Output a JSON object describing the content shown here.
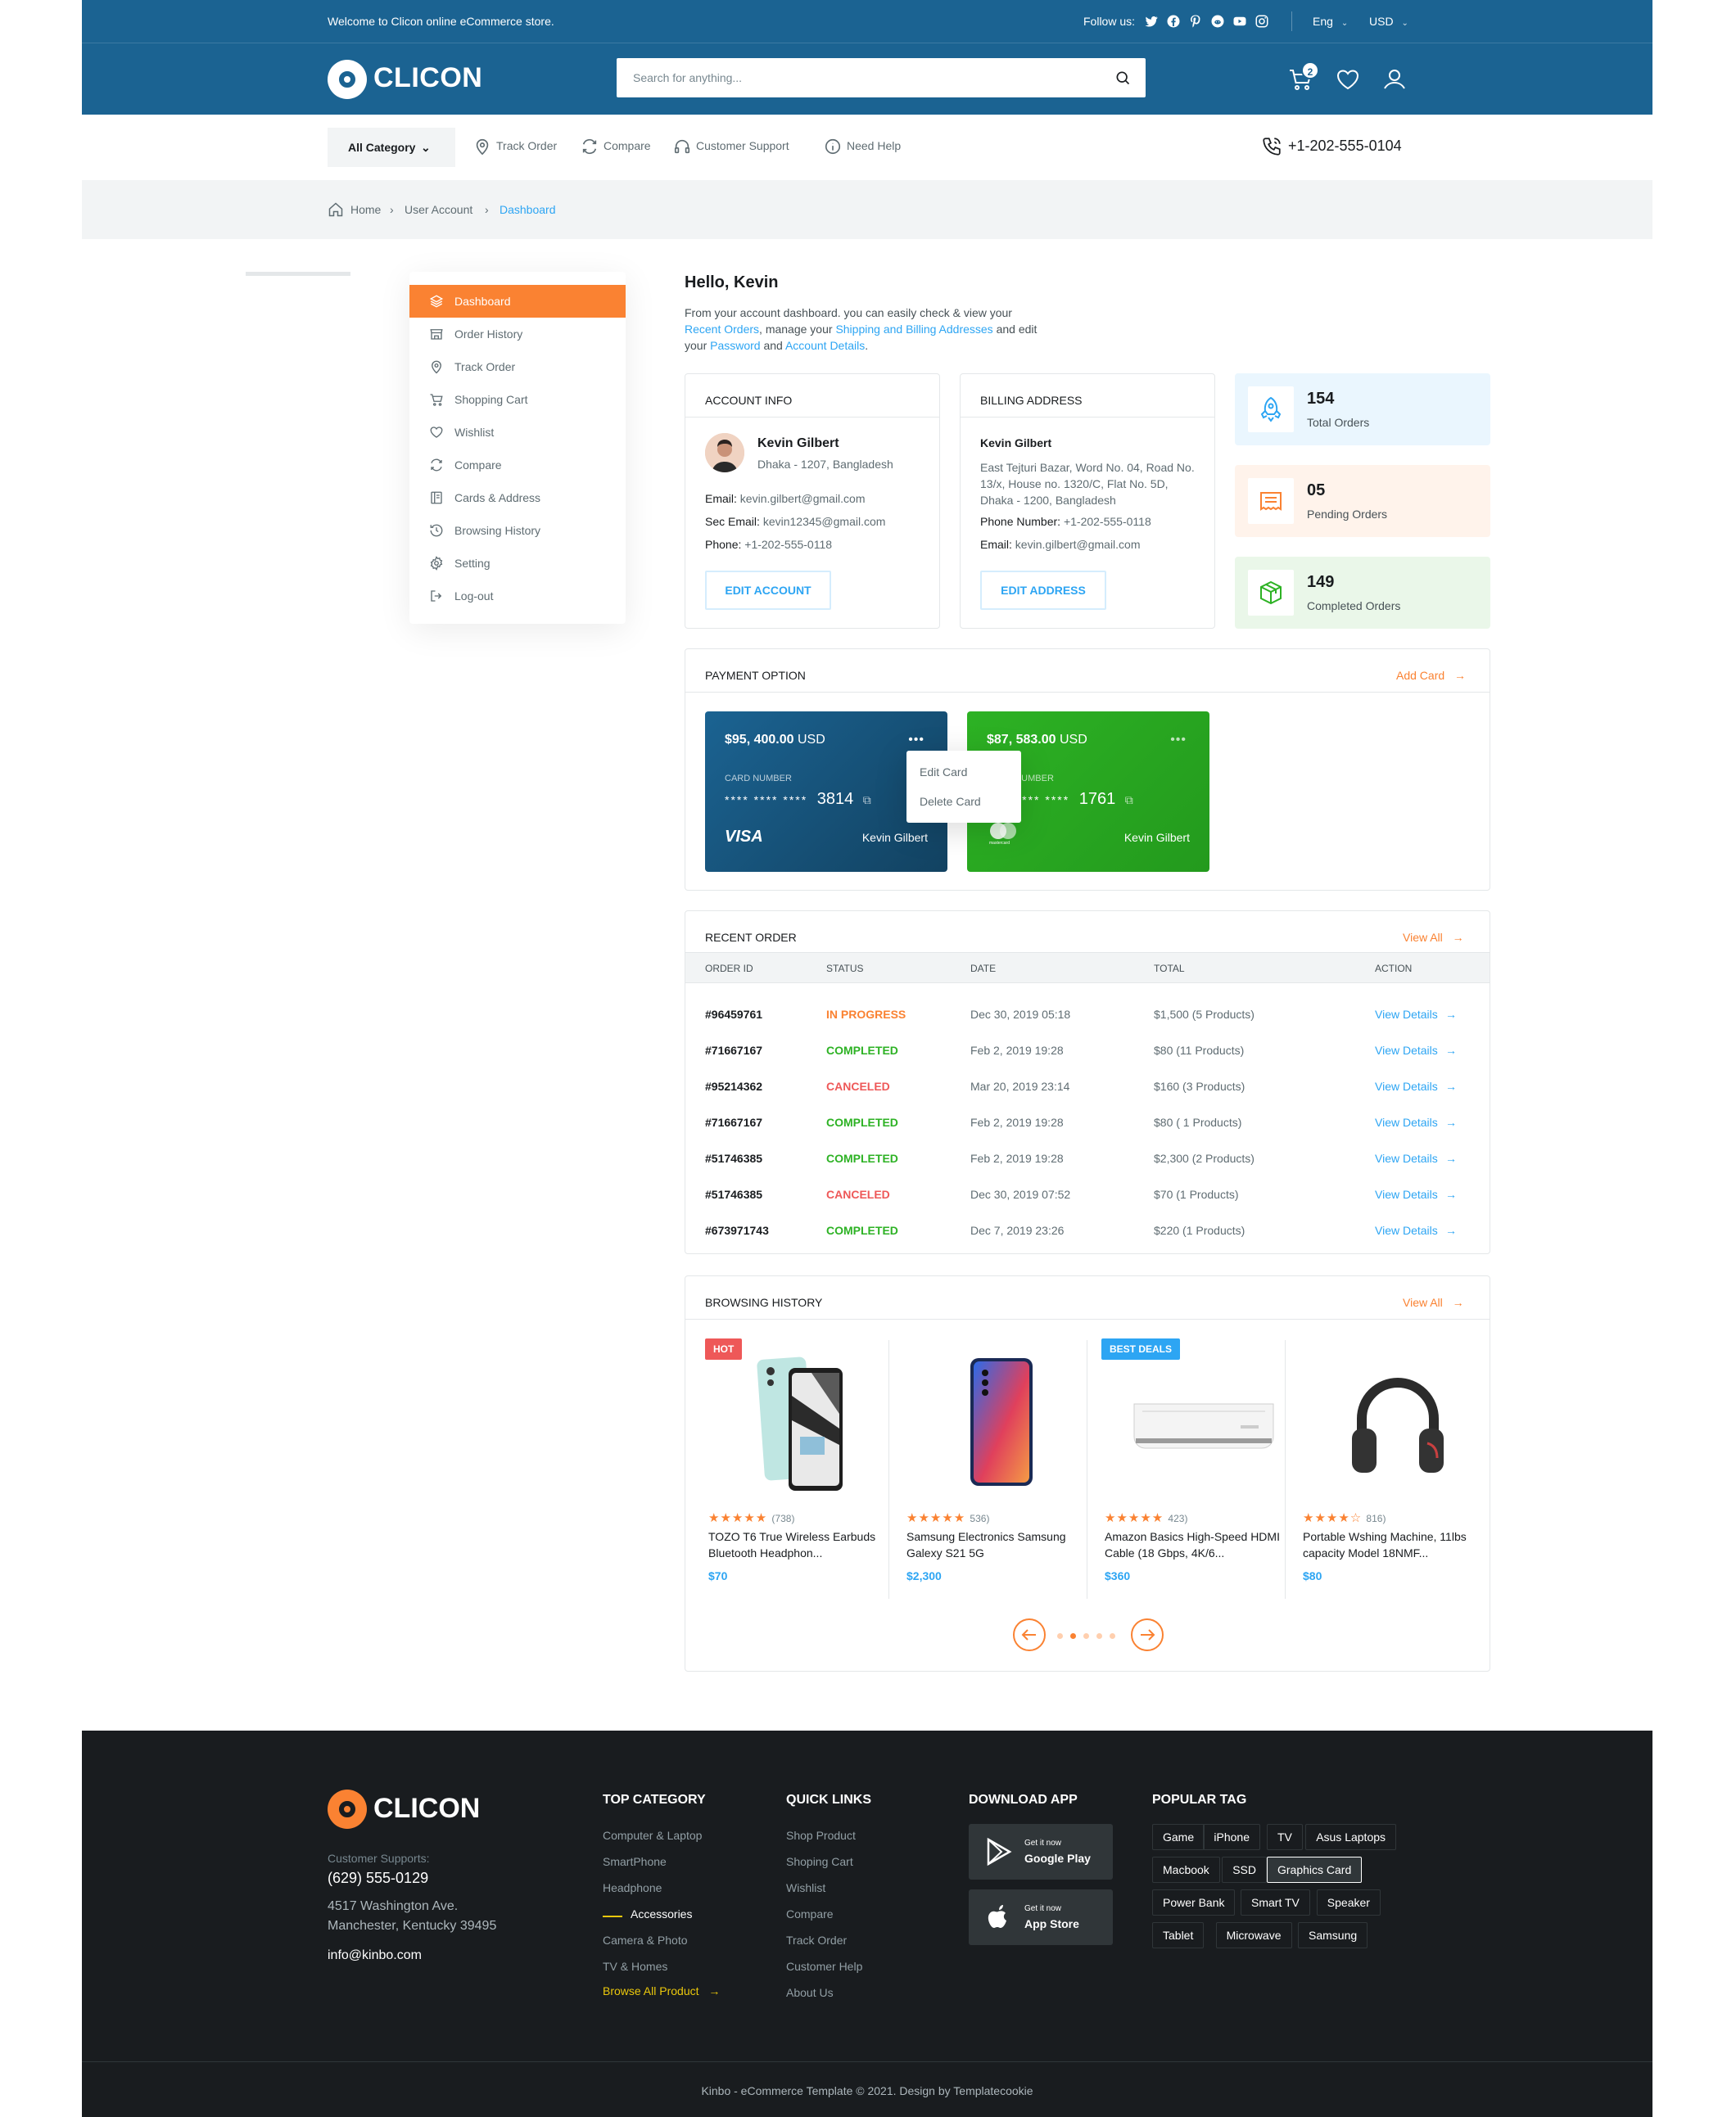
{
  "topbar": {
    "welcome": "Welcome to Clicon online eCommerce store.",
    "follow_label": "Follow us:",
    "social_icons": [
      "twitter-icon",
      "facebook-icon",
      "pinterest-icon",
      "reddit-icon",
      "youtube-icon",
      "instagram-icon"
    ],
    "language": "Eng",
    "currency": "USD"
  },
  "header": {
    "logo_text": "CLICON",
    "search_placeholder": "Search for anything...",
    "cart_count": "2"
  },
  "nav": {
    "all_category": "All Category",
    "items": [
      "Track Order",
      "Compare",
      "Customer Support",
      "Need Help"
    ],
    "phone": "+1-202-555-0104"
  },
  "breadcrumb": [
    "Home",
    "User Account",
    "Dashboard"
  ],
  "sidebar": {
    "items": [
      "Dashboard",
      "Order History",
      "Track Order",
      "Shopping Cart",
      "Wishlist",
      "Compare",
      "Cards & Address",
      "Browsing History",
      "Setting",
      "Log-out"
    ],
    "active_index": 0
  },
  "greeting": {
    "title": "Hello, Kevin",
    "intro_1": "From your account dashboard. you can easily check & view your ",
    "link_1": "Recent Orders",
    "intro_2": ", manage your ",
    "link_2": "Shipping and Billing Addresses",
    "intro_3": " and edit your ",
    "link_3": "Password",
    "intro_4": " and ",
    "link_4": "Account Details",
    "intro_5": "."
  },
  "account_info": {
    "title": "ACCOUNT INFO",
    "name": "Kevin Gilbert",
    "location": "Dhaka - 1207, Bangladesh",
    "email_label": "Email:",
    "email": "kevin.gilbert@gmail.com",
    "sec_email_label": "Sec Email:",
    "sec_email": "kevin12345@gmail.com",
    "phone_label": "Phone:",
    "phone": "+1-202-555-0118",
    "button": "EDIT ACCOUNT"
  },
  "billing_address": {
    "title": "BILLING ADDRESS",
    "name": "Kevin Gilbert",
    "address": "East Tejturi Bazar, Word No. 04, Road No. 13/x, House no. 1320/C, Flat No. 5D, Dhaka - 1200, Bangladesh",
    "phone_label": "Phone Number:",
    "phone": "+1-202-555-0118",
    "email_label": "Email:",
    "email": "kevin.gilbert@gmail.com",
    "button": "EDIT ADDRESS"
  },
  "stats": [
    {
      "value": "154",
      "label": "Total Orders",
      "bg": "#eaf6fe",
      "icon": "rocket-icon"
    },
    {
      "value": "05",
      "label": "Pending Orders",
      "bg": "#fff3eb",
      "icon": "receipt-icon"
    },
    {
      "value": "149",
      "label": "Completed Orders",
      "bg": "#eaf7e9",
      "icon": "package-icon"
    }
  ],
  "payment": {
    "title": "PAYMENT OPTION",
    "add_card": "Add Card",
    "cards": [
      {
        "amount": "$95, 400.00",
        "currency": "USD",
        "label": "CARD NUMBER",
        "masked": "**** **** ****",
        "last4": "3814",
        "owner": "Kevin Gilbert",
        "brand": "VISA"
      },
      {
        "amount": "$87, 583.00",
        "currency": "USD",
        "label": "CARD NUMBER",
        "masked": "**** **** ****",
        "last4": "1761",
        "owner": "Kevin Gilbert",
        "brand": "mastercard"
      }
    ],
    "menu": [
      "Edit Card",
      "Delete Card"
    ]
  },
  "recent_order": {
    "title": "RECENT ORDER",
    "view_all": "View All",
    "columns": [
      "ORDER ID",
      "STATUS",
      "DATE",
      "TOTAL",
      "ACTION"
    ],
    "rows": [
      {
        "id": "#96459761",
        "status": "IN PROGRESS",
        "date": "Dec 30, 2019 05:18",
        "total": "$1,500 (5 Products)",
        "action": "View Details"
      },
      {
        "id": "#71667167",
        "status": "COMPLETED",
        "date": "Feb 2, 2019 19:28",
        "total": "$80 (11 Products)",
        "action": "View Details"
      },
      {
        "id": "#95214362",
        "status": "CANCELED",
        "date": "Mar 20, 2019 23:14",
        "total": "$160 (3 Products)",
        "action": "View Details"
      },
      {
        "id": "#71667167",
        "status": "COMPLETED",
        "date": "Feb 2, 2019 19:28",
        "total": "$80 ( 1 Products)",
        "action": "View Details"
      },
      {
        "id": "#51746385",
        "status": "COMPLETED",
        "date": "Feb 2, 2019 19:28",
        "total": "$2,300 (2 Products)",
        "action": "View Details"
      },
      {
        "id": "#51746385",
        "status": "CANCELED",
        "date": "Dec 30, 2019 07:52",
        "total": "$70 (1 Products)",
        "action": "View Details"
      },
      {
        "id": "#673971743",
        "status": "COMPLETED",
        "date": "Dec 7, 2019 23:26",
        "total": "$220 (1 Products)",
        "action": "View Details"
      }
    ]
  },
  "browsing_history": {
    "title": "BROWSING HISTORY",
    "view_all": "View All",
    "products": [
      {
        "badge": "HOT",
        "badge_color": "#ee5858",
        "stars": "★★★★★",
        "reviews": "(738)",
        "name": "TOZO T6 True Wireless Earbuds Bluetooth Headphon...",
        "price": "$70"
      },
      {
        "badge": "",
        "badge_color": "",
        "stars": "★★★★★",
        "reviews": "536)",
        "name": "Samsung Electronics Samsung Galexy S21 5G",
        "price": "$2,300"
      },
      {
        "badge": "BEST DEALS",
        "badge_color": "#2da5f3",
        "stars": "★★★★★",
        "reviews": "423)",
        "name": "Amazon Basics High-Speed HDMI Cable (18 Gbps, 4K/6...",
        "price": "$360"
      },
      {
        "badge": "",
        "badge_color": "",
        "stars": "★★★★☆",
        "reviews": "816)",
        "name": "Portable Wshing Machine, 11lbs capacity Model 18NMF...",
        "price": "$80"
      }
    ],
    "pagination": {
      "pages": 5,
      "active": 1
    }
  },
  "footer": {
    "logo_text": "CLICON",
    "support_label": "Customer Supports:",
    "phone": "(629) 555-0129",
    "address_1": "4517 Washington Ave.",
    "address_2": "Manchester, Kentucky 39495",
    "email": "info@kinbo.com",
    "top_category": {
      "title": "TOP CATEGORY",
      "items": [
        "Computer & Laptop",
        "SmartPhone",
        "Headphone",
        "Accessories",
        "Camera & Photo",
        "TV & Homes"
      ],
      "browse_all": "Browse All Product"
    },
    "quick_links": {
      "title": "QUICK LINKS",
      "items": [
        "Shop Product",
        "Shoping Cart",
        "Wishlist",
        "Compare",
        "Track Order",
        "Customer Help",
        "About Us"
      ]
    },
    "download": {
      "title": "DOWNLOAD APP",
      "apps": [
        {
          "small": "Get it now",
          "big": "Google Play"
        },
        {
          "small": "Get it now",
          "big": "App Store"
        }
      ]
    },
    "popular_tag": {
      "title": "POPULAR TAG",
      "tags": [
        "Game",
        "iPhone",
        "TV",
        "Asus Laptops",
        "Macbook",
        "SSD",
        "Graphics Card",
        "Power Bank",
        "Smart TV",
        "Speaker",
        "Tablet",
        "Microwave",
        "Samsung"
      ],
      "highlighted": "Graphics Card"
    },
    "copyright": "Kinbo - eCommerce Template © 2021. Design by Templatecookie"
  }
}
